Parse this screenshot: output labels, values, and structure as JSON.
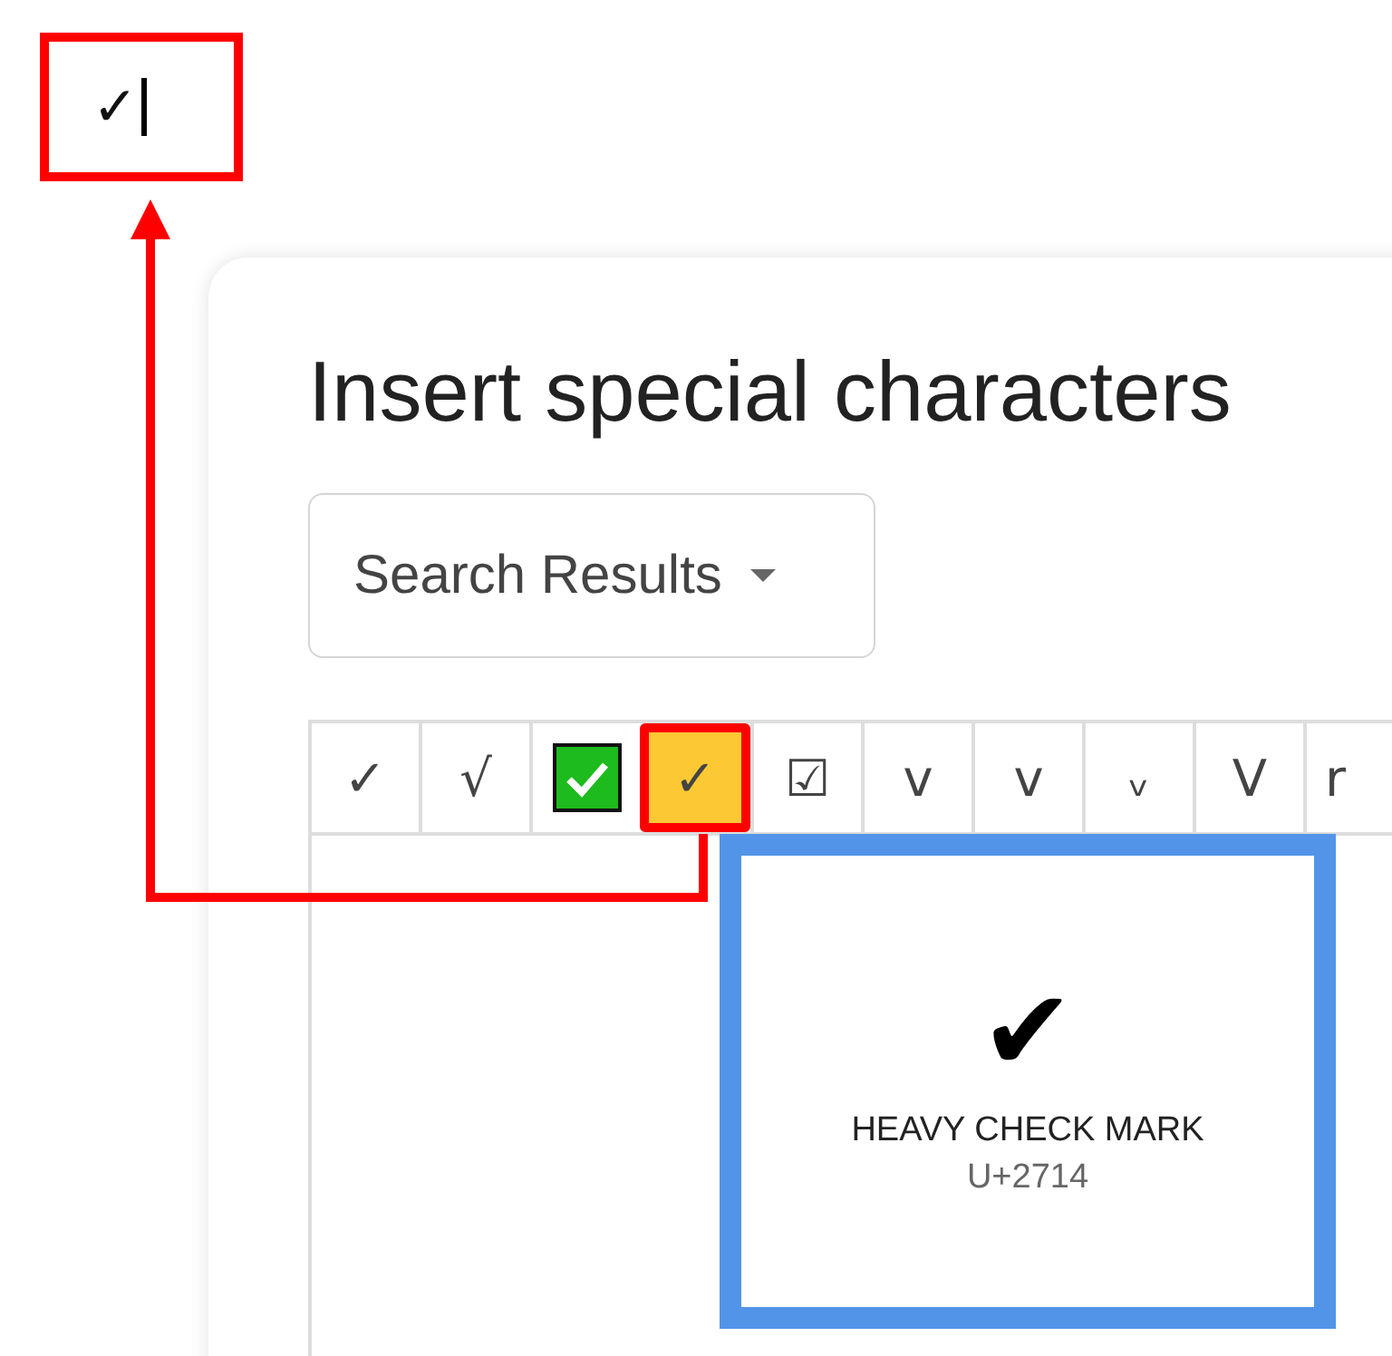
{
  "output_box": {
    "text": "✓"
  },
  "dialog": {
    "title": "Insert special characters",
    "category_dropdown": {
      "label": "Search Results"
    },
    "characters": [
      {
        "kind": "glyph",
        "char": "✓",
        "selected": false
      },
      {
        "kind": "glyph",
        "char": "√",
        "selected": false
      },
      {
        "kind": "emoji",
        "selected": false
      },
      {
        "kind": "glyph",
        "char": "✓",
        "selected": true
      },
      {
        "kind": "glyph",
        "char": "☑",
        "selected": false
      },
      {
        "kind": "glyph",
        "char": "v",
        "selected": false
      },
      {
        "kind": "glyph",
        "char": "v",
        "selected": false
      },
      {
        "kind": "glyph",
        "char": "ᵥ",
        "selected": false
      },
      {
        "kind": "glyph",
        "char": "V",
        "selected": false
      },
      {
        "kind": "glyph",
        "char": "r",
        "selected": false
      }
    ],
    "preview": {
      "char": "✔",
      "name": "HEAVY CHECK MARK",
      "code": "U+2714"
    }
  }
}
